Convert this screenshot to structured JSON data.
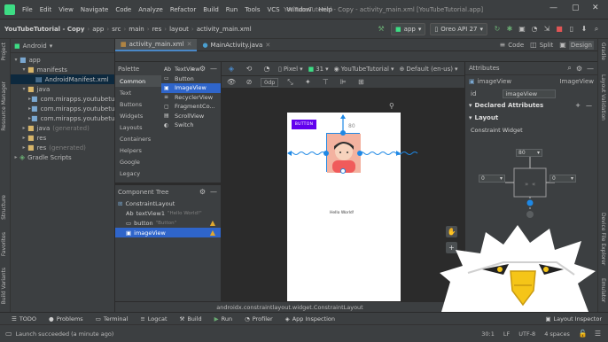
{
  "menu": {
    "items": [
      "File",
      "Edit",
      "View",
      "Navigate",
      "Code",
      "Analyze",
      "Refactor",
      "Build",
      "Run",
      "Tools",
      "VCS",
      "Window",
      "Help"
    ],
    "window_title": "YouTubeTutorial - Copy - activity_main.xml [YouTubeTutorial.app]"
  },
  "nav": {
    "crumbs": [
      "YouTubeTutorial - Copy",
      "app",
      "src",
      "main",
      "res",
      "layout",
      "activity_main.xml"
    ],
    "run_config": "app",
    "device": "Oreo API 27"
  },
  "project": {
    "view_label": "Android",
    "tree": [
      {
        "label": "app",
        "kind": "module"
      },
      {
        "label": "manifests",
        "kind": "folder"
      },
      {
        "label": "AndroidManifest.xml",
        "kind": "file",
        "selected": true
      },
      {
        "label": "java",
        "kind": "folder"
      },
      {
        "label": "com.mirapps.youtubetutorial",
        "kind": "package"
      },
      {
        "label": "com.mirapps.youtubetutorial",
        "kind": "package"
      },
      {
        "label": "com.mirapps.youtubetutorial",
        "kind": "package"
      },
      {
        "label": "java",
        "suffix": "(generated)",
        "kind": "folder"
      },
      {
        "label": "res",
        "kind": "folder"
      },
      {
        "label": "res",
        "suffix": "(generated)",
        "kind": "folder"
      },
      {
        "label": "Gradle Scripts",
        "kind": "gradle"
      }
    ]
  },
  "side_tools": {
    "left": [
      "Project",
      "Resource Manager",
      "Structure",
      "Favorites",
      "Build Variants"
    ],
    "right": [
      "Gradle",
      "Layout Validation",
      "Device File Explorer",
      "Emulator"
    ]
  },
  "tabs": [
    {
      "label": "activity_main.xml",
      "active": true
    },
    {
      "label": "MainActivity.java",
      "active": false
    }
  ],
  "view_modes": {
    "code": "Code",
    "split": "Split",
    "design": "Design"
  },
  "palette": {
    "title": "Palette",
    "categories": [
      "Common",
      "Text",
      "Buttons",
      "Widgets",
      "Layouts",
      "Containers",
      "Helpers",
      "Google",
      "Legacy"
    ],
    "items": [
      {
        "icon": "Ab",
        "label": "TextView"
      },
      {
        "icon": "▭",
        "label": "Button"
      },
      {
        "icon": "▣",
        "label": "ImageView",
        "selected": true
      },
      {
        "icon": "≡",
        "label": "RecyclerView"
      },
      {
        "icon": "▢",
        "label": "FragmentCo..."
      },
      {
        "icon": "▤",
        "label": "ScrollView"
      },
      {
        "icon": "◐",
        "label": "Switch"
      }
    ]
  },
  "component_tree": {
    "title": "Component Tree",
    "root": "ConstraintLayout",
    "children": [
      {
        "icon": "Ab",
        "label": "textView1",
        "hint": "\"Hello World!\"",
        "warn": false,
        "selected": false
      },
      {
        "icon": "▭",
        "label": "button",
        "hint": "\"Button\"",
        "warn": true,
        "selected": false
      },
      {
        "icon": "▣",
        "label": "imageView",
        "hint": "",
        "warn": true,
        "selected": true
      }
    ]
  },
  "design_toolbar": {
    "device": "Pixel",
    "api": "31",
    "theme": "YouTubeTutorial",
    "locale": "Default (en-us)",
    "margin": "0dp"
  },
  "preview": {
    "button_label": "BUTTON",
    "hello_text": "Hello World!",
    "margin_top": "80"
  },
  "layout_path": "androidx.constraintlayout.widget.ConstraintLayout",
  "attributes": {
    "title": "Attributes",
    "component": "imageView",
    "component_type": "ImageView",
    "id_label": "id",
    "id_value": "imageView",
    "declared": "Declared Attributes",
    "layout": "Layout",
    "constraint_widget": "Constraint Widget",
    "margins": {
      "top": "80",
      "left": "0",
      "right": "0"
    }
  },
  "bottom_tools": [
    "TODO",
    "Problems",
    "Terminal",
    "Logcat",
    "Build",
    "Run",
    "Profiler",
    "App Inspection"
  ],
  "layout_inspector": "Layout Inspector",
  "status": {
    "message": "Launch succeeded (a minute ago)",
    "position": "30:1",
    "line_sep": "LF",
    "encoding": "UTF-8",
    "indent": "4 spaces"
  },
  "colors": {
    "accent": "#4a88c7",
    "selection": "#2f65ca",
    "button_purple": "#6200ee",
    "warning": "#e0a82e",
    "constraint_blue": "#1e88e5"
  }
}
